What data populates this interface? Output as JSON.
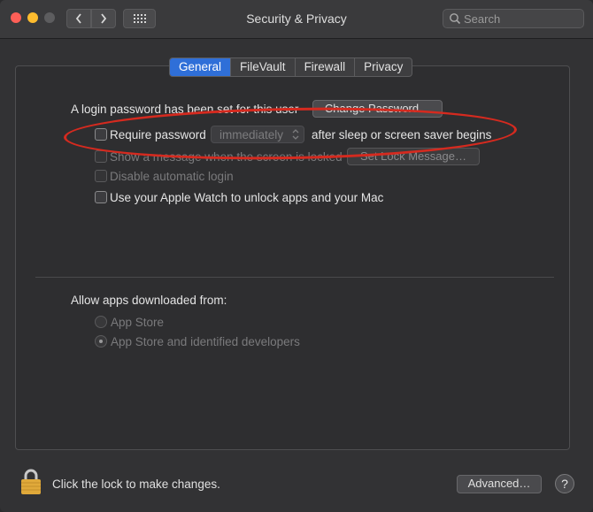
{
  "window": {
    "title": "Security & Privacy",
    "search_placeholder": "Search"
  },
  "tabs": [
    {
      "label": "General",
      "active": true
    },
    {
      "label": "FileVault",
      "active": false
    },
    {
      "label": "Firewall",
      "active": false
    },
    {
      "label": "Privacy",
      "active": false
    }
  ],
  "general": {
    "login_text": "A login password has been set for this user",
    "change_password_label": "Change Password…",
    "require_password": {
      "label": "Require password",
      "checked": false
    },
    "require_delay_value": "immediately",
    "require_suffix": "after sleep or screen saver begins",
    "show_message": {
      "label": "Show a message when the screen is locked",
      "checked": false,
      "enabled": false
    },
    "set_lock_message_label": "Set Lock Message…",
    "disable_auto_login": {
      "label": "Disable automatic login",
      "checked": false,
      "enabled": false
    },
    "apple_watch": {
      "label": "Use your Apple Watch to unlock apps and your Mac",
      "checked": false
    }
  },
  "allow_apps": {
    "heading": "Allow apps downloaded from:",
    "options": [
      {
        "label": "App Store",
        "selected": false
      },
      {
        "label": "App Store and identified developers",
        "selected": true
      }
    ]
  },
  "footer": {
    "lock_text": "Click the lock to make changes.",
    "advanced_label": "Advanced…",
    "help_label": "?"
  },
  "colors": {
    "accent": "#2f6fd8",
    "annotation": "#d52a1f",
    "lock": "#e0a93a"
  },
  "icons": {
    "back": "chevron-left-icon",
    "forward": "chevron-right-icon",
    "grid": "grid-icon",
    "search": "search-icon",
    "lock": "lock-icon",
    "popup": "up-down-arrows-icon"
  }
}
